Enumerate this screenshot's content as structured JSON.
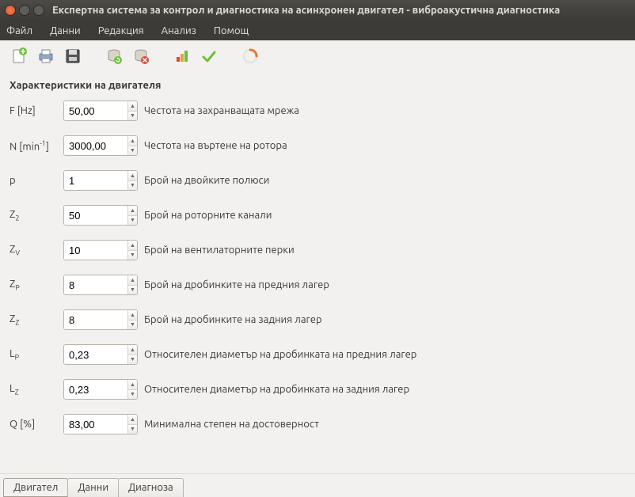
{
  "window": {
    "title": "Експертна система за контрол и диагностика на асинхронен двигател - виброакустична диагностика"
  },
  "menu": {
    "file": "Файл",
    "data": "Данни",
    "edit": "Редакция",
    "analysis": "Анализ",
    "help": "Помощ"
  },
  "toolbar_icons": {
    "new": "new-doc-icon",
    "print": "print-icon",
    "save": "save-icon",
    "db_refresh": "db-refresh-icon",
    "db_delete": "db-delete-icon",
    "chart": "chart-icon",
    "check": "check-icon",
    "loader": "loader-icon"
  },
  "section_title": "Характеристики на двигателя",
  "fields": [
    {
      "id": "f",
      "label_html": "F [Hz]",
      "value": "50,00",
      "desc": "Честота на захранващата мрежа"
    },
    {
      "id": "n",
      "label_html": "N [min<sup>-1</sup>]",
      "value": "3000,00",
      "desc": "Честота на въртене на ротора"
    },
    {
      "id": "p",
      "label_html": "p",
      "value": "1",
      "desc": "Брой на двойките полюси"
    },
    {
      "id": "z2",
      "label_html": "Z<sub>2</sub>",
      "value": "50",
      "desc": "Брой на роторните канали"
    },
    {
      "id": "zv",
      "label_html": "Z<sub>V</sub>",
      "value": "10",
      "desc": "Брой на вентилаторните перки"
    },
    {
      "id": "zp",
      "label_html": "Z<sub>P</sub>",
      "value": "8",
      "desc": "Брой на дробинките на предния лагер"
    },
    {
      "id": "zz",
      "label_html": "Z<sub>Z</sub>",
      "value": "8",
      "desc": "Брой на дробинките на задния лагер"
    },
    {
      "id": "lp",
      "label_html": "L<sub>P</sub>",
      "value": "0,23",
      "desc": "Относителен диаметър на дробинката на предния лагер"
    },
    {
      "id": "lz",
      "label_html": "L<sub>Z</sub>",
      "value": "0,23",
      "desc": "Относителен диаметър на дробинката на задния лагер"
    },
    {
      "id": "q",
      "label_html": "Q [%]",
      "value": "83,00",
      "desc": "Минимална степен на достоверност"
    }
  ],
  "tabs": [
    {
      "id": "engine",
      "label": "Двигател",
      "active": true
    },
    {
      "id": "data",
      "label": "Данни",
      "active": false
    },
    {
      "id": "diag",
      "label": "Диагноза",
      "active": false
    }
  ]
}
